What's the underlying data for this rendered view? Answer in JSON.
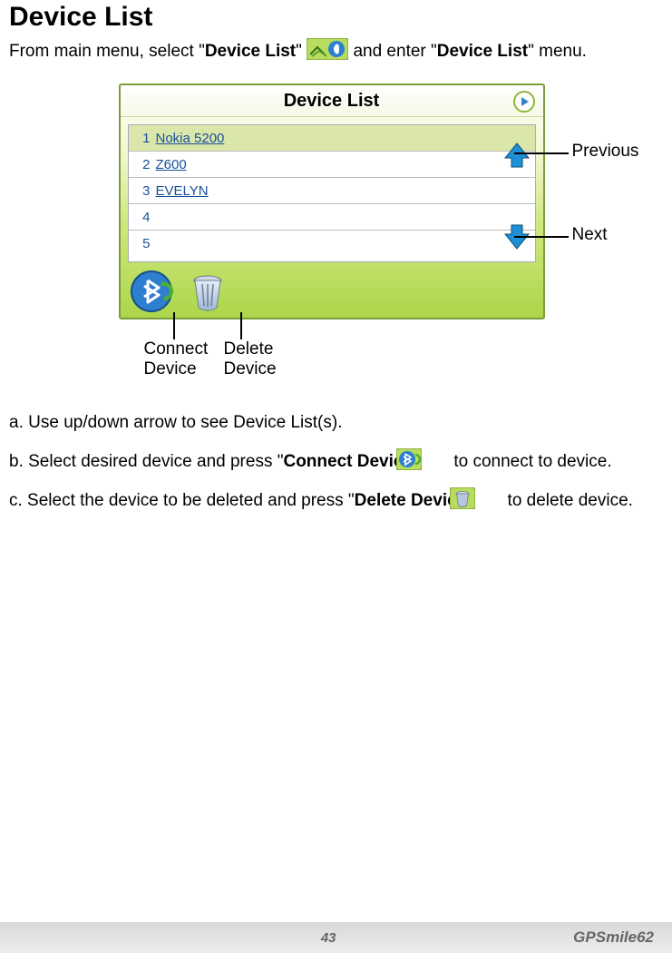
{
  "heading": "Device List",
  "intro": {
    "prefix": "From main menu, select \"",
    "bold1": "Device List",
    "mid": "\" ",
    "afterIcon": " and enter \"",
    "bold2": "Device List",
    "suffix": "\" menu."
  },
  "screenshot": {
    "title": "Device List",
    "rows": [
      {
        "n": "1",
        "name": "Nokia 5200"
      },
      {
        "n": "2",
        "name": "Z600"
      },
      {
        "n": "3",
        "name": "EVELYN"
      },
      {
        "n": "4",
        "name": ""
      },
      {
        "n": "5",
        "name": ""
      }
    ]
  },
  "callouts": {
    "previous": "Previous",
    "next": "Next",
    "connect": "Connect Device",
    "delete": "Delete Device"
  },
  "steps": {
    "a": "a.  Use up/down arrow to see Device List(s).",
    "b_pre": "b.  Select desired device and press \"",
    "b_bold": "Connect Device",
    "b_mid": "\" ",
    "b_post": " to connect to device.",
    "c_pre": "c.  Select the device to be deleted and press \"",
    "c_bold": "Delete Device",
    "c_mid": "\" ",
    "c_post": " to delete device."
  },
  "footer": {
    "page": "43",
    "brand": "GPSmile62"
  }
}
